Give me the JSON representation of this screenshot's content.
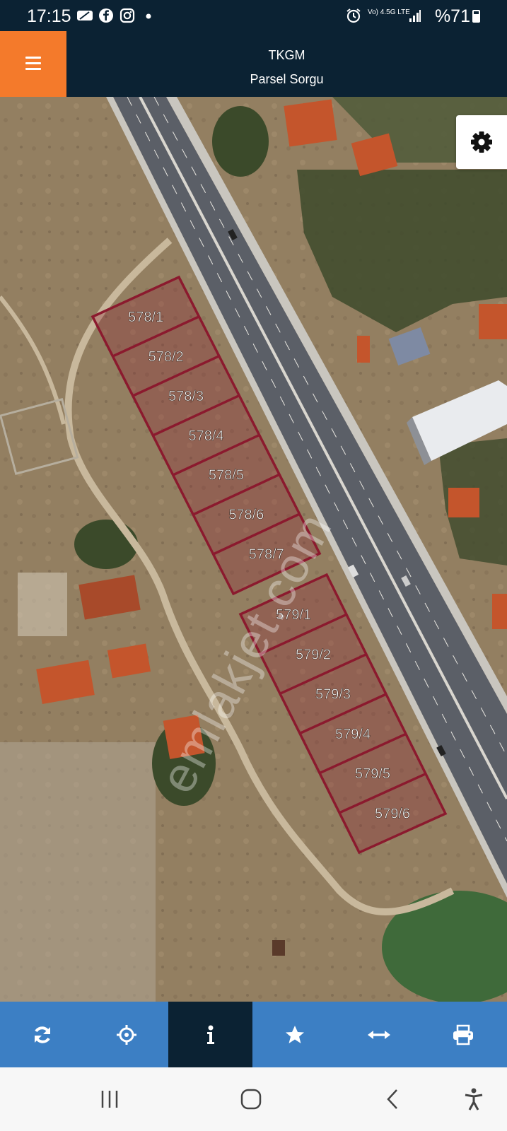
{
  "status_bar": {
    "time": "17:15",
    "icons": [
      "video-call-icon",
      "facebook-icon",
      "instagram-icon",
      "dot-icon"
    ],
    "network": "Vo) 4.5G LTE",
    "battery_text": "%71",
    "battery_level": 0.71
  },
  "header": {
    "title": "TKGM",
    "subtitle": "Parsel Sorgu",
    "menu_icon": "hamburger-icon",
    "accent_color": "#f47a2b",
    "bar_color": "#0b2233"
  },
  "map": {
    "settings_icon": "gear-icon",
    "parcel_outline_color": "#8b1a2e",
    "parcels_578": [
      "578/1",
      "578/2",
      "578/3",
      "578/4",
      "578/5",
      "578/6",
      "578/7"
    ],
    "parcels_579": [
      "579/1",
      "579/2",
      "579/3",
      "579/4",
      "579/5",
      "579/6"
    ],
    "watermark": "emlakjet.com"
  },
  "toolbar": {
    "buttons": [
      {
        "name": "refresh",
        "icon": "refresh-icon"
      },
      {
        "name": "locate",
        "icon": "crosshair-icon"
      },
      {
        "name": "info",
        "icon": "info-icon",
        "active": true
      },
      {
        "name": "favorite",
        "icon": "star-icon"
      },
      {
        "name": "measure",
        "icon": "arrows-horizontal-icon"
      },
      {
        "name": "print",
        "icon": "printer-icon"
      }
    ],
    "bar_color": "#3c7fc4"
  },
  "nav_bar": {
    "buttons": [
      "recent-apps-icon",
      "home-icon",
      "back-icon",
      "accessibility-icon"
    ]
  }
}
